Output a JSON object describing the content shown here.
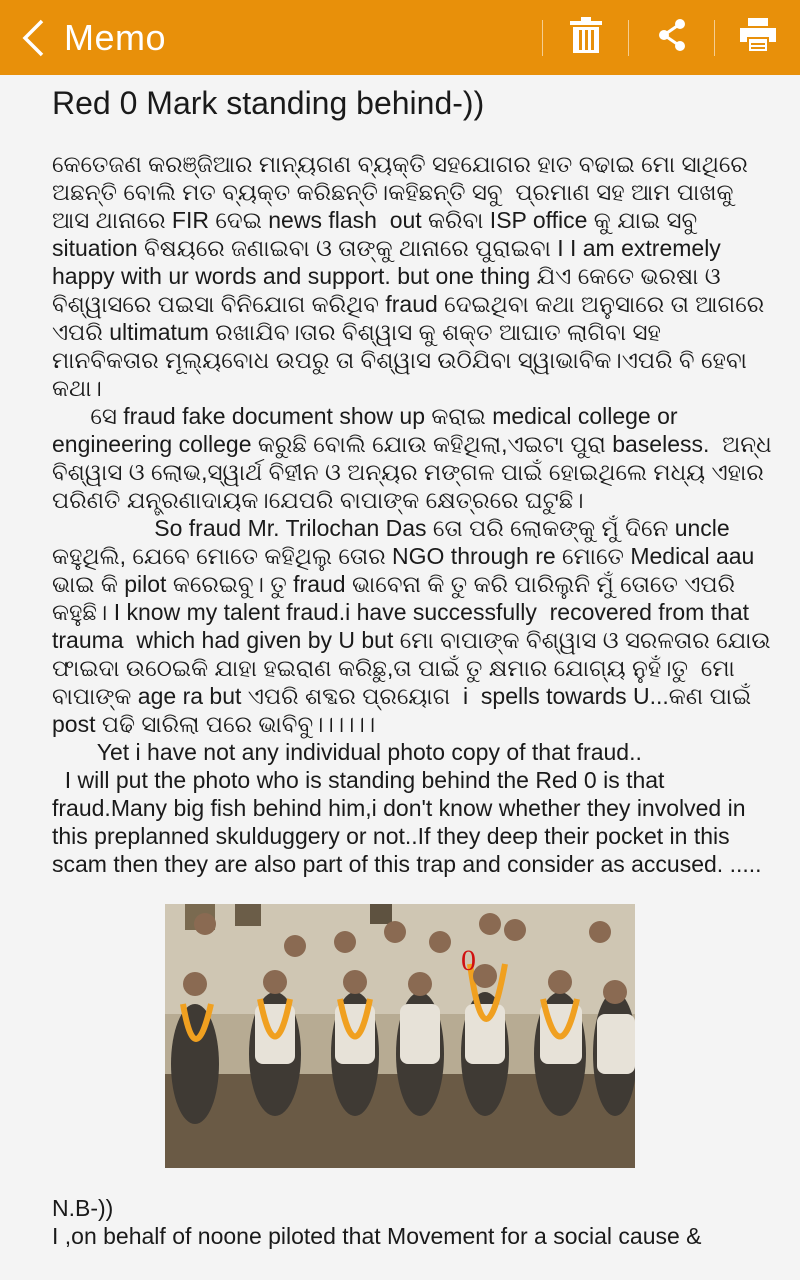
{
  "appbar": {
    "title": "Memo",
    "back_icon": "chevron-left-icon",
    "actions": [
      "trash-icon",
      "share-icon",
      "print-icon"
    ],
    "color": "#e8900a"
  },
  "memo": {
    "title": "Red 0 Mark standing behind-))",
    "paragraphs": [
      "କେତେଜଣ କରଞ୍ଜିଆର ମାନ୍ୟଗଣ ବ୍ୟକ୍ତି ସହଯୋଗର ହାତ ବଢାଇ ମୋ ସାଥିରେ ଅଛନ୍ତି ବୋଲି ମତ ବ୍ୟକ୍ତ କରିଛନ୍ତି।କହିଛନ୍ତି ସବୁ  ପ୍ରମାଣ ସହ ଆମ ପାଖକୁ ଆସ ଥାନାରେ FIR ଦେଇ news flash  out କରିବା ISP office କୁ ଯାଇ ସବୁ situation ବିଷୟରେ ଜଣାଇବା ଓ ତାଙ୍କୁ ଥାନାରେ ପୁରାଇବା I I am extremely happy with ur words and support. but one thing ଯିଏ କେତେ ଭରଷା ଓ ବିଶ୍ୱାସରେ ପଇସା ବିନିଯୋଗ କରିଥିବ fraud ଦେଇଥିବା କଥା ଅନୁସାରେ ତା ଆଗରେ ଏପରି ultimatum ରଖାଯିବ।ତାର ବିଶ୍ୱାସ କୁ ଶକ୍ତ ଆଘାତ ଲାଗିବା ସହ ମାନବିକତାର ମୂଲ୍ୟବୋଧ ଉପରୁ ତା ବିଶ୍ୱାସ ଉଠିଯିବା ସ୍ୱାଭାବିକ।ଏପରି ବି ହେବା କଥା।",
      "      ସେ fraud fake document show up କରାଇ medical college or engineering college କରୁଛି ବୋଲି ଯୋଉ କହିଥିଲା,ଏଇଟା ପୁରା baseless.  ଅନ୍ଧ ବିଶ୍ୱାସ ଓ ଲୋଭ,ସ୍ୱାର୍ଥ ବିହୀନ ଓ ଅନ୍ୟର ମଙ୍ଗଳ ପାଇଁ ହୋଇଥିଲେ ମଧ୍ୟ ଏହାର ପରିଣତି ଯନ୍ତ୍ରଣାଦାୟକ।ଯେପରି ବାପାଙ୍କ କ୍ଷେତ୍ରରେ ଘଟୁଛି।",
      "",
      "                So fraud Mr. Trilochan Das ତୋ ପରି ଲୋକଙ୍କୁ ମୁଁ ଦିନେ uncle କହୁଥିଲି, ଯେବେ ମୋତେ କହିଥିଲୁ ତୋର NGO through re ମୋତେ Medical aau ଭାଇ କି pilot କରେଇବୁ। ତୁ fraud ଭାବେନା କି ତୁ କରି ପାରିଲୁନି ମୁଁ ତୋତେ ଏପରି କହୁଛି। I know my talent fraud.i have successfully  recovered from that trauma  which had given by U but ମୋ ବାପାଙ୍କ ବିଶ୍ୱାସ ଓ ସରଳତାର ଯୋଉ ଫାଇଦା ଉଠେଇକି ଯାହା ହଇରାଣ କରିଛୁ,ତା ପାଇଁ ତୁ କ୍ଷମାର ଯୋଗ୍ୟ ନୁହଁ।ତୁ  ମୋ ବାପାଙ୍କ age ra but ଏପରି ଶବ୍ଦର ପ୍ରୟୋଗ  i  spells towards U...କଣ ପାଇଁ post ପଢି ସାରିଲା ପରେ ଭାବିବୁ।।।।।।",
      "       Yet i have not any individual photo copy of that fraud..\n  I will put the photo who is standing behind the Red 0 is that fraud.Many big fish behind him,i don't know whether they involved in this preplanned skulduggery or not..If they deep their pocket in this scam then they are also part of this trap and consider as accused. ....."
    ],
    "photo_mark": "0",
    "nb_label": "N.B-))",
    "last_line": "I ,on behalf of noone piloted that Movement for a social cause &"
  }
}
